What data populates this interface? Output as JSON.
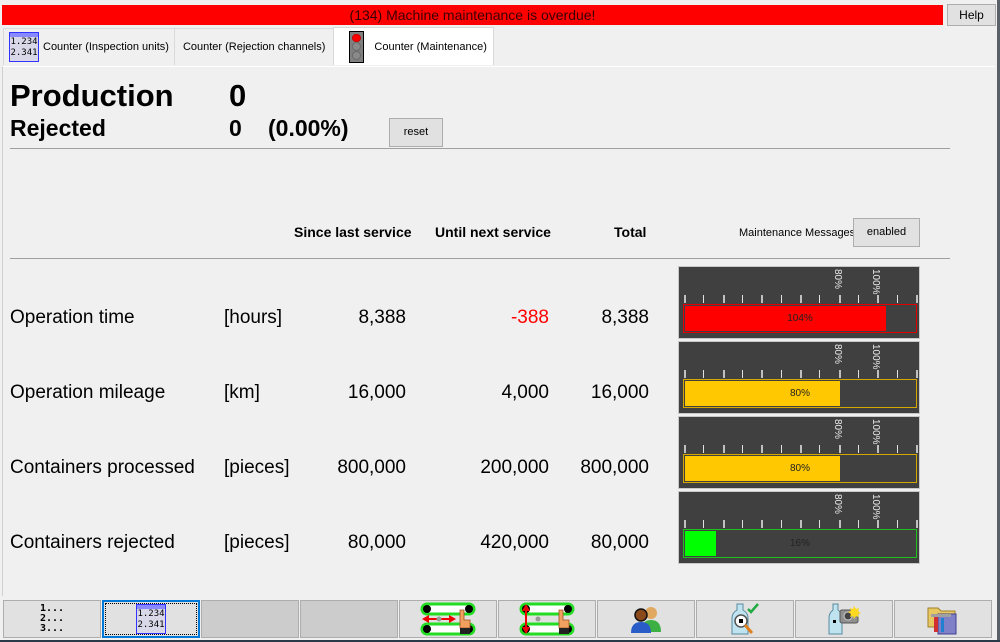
{
  "alarm": {
    "message": "(134) Machine maintenance is overdue!"
  },
  "help": {
    "label": "Help"
  },
  "tabs": [
    {
      "label": "Counter (Inspection units)",
      "icon": "counter-icon",
      "icon_text": [
        "1.234",
        "2.341"
      ]
    },
    {
      "label": "Counter (Rejection channels)"
    },
    {
      "label": "Counter (Maintenance)",
      "icon": "traffic-light-icon",
      "active": true
    }
  ],
  "summary": {
    "production_label": "Production",
    "production_value": "0",
    "rejected_label": "Rejected",
    "rejected_value": "0",
    "rejected_percent": "(0.00%)",
    "reset_label": "reset"
  },
  "table": {
    "headers": {
      "since_last_service": "Since last service",
      "until_next_service": "Until next service",
      "total": "Total"
    },
    "maintenance_messages_label": "Maintenance Messages",
    "maintenance_messages_button": "enabled",
    "rows": [
      {
        "label": "Operation time",
        "unit": "[hours]",
        "since": "8,388",
        "until": "-388",
        "until_negative": true,
        "total": "8,388",
        "gauge": {
          "percent": 104,
          "text": "104%",
          "color": "#ff0000",
          "border": "#e00000"
        }
      },
      {
        "label": "Operation mileage",
        "unit": "[km]",
        "since": "16,000",
        "until": "4,000",
        "total": "16,000",
        "gauge": {
          "percent": 80,
          "text": "80%",
          "color": "#ffc800",
          "border": "#d4a800"
        }
      },
      {
        "label": "Containers processed",
        "unit": "[pieces]",
        "since": "800,000",
        "until": "200,000",
        "total": "800,000",
        "gauge": {
          "percent": 80,
          "text": "80%",
          "color": "#ffc800",
          "border": "#d4a800"
        }
      },
      {
        "label": "Containers rejected",
        "unit": "[pieces]",
        "since": "80,000",
        "until": "420,000",
        "total": "80,000",
        "gauge": {
          "percent": 16,
          "text": "16%",
          "color": "#00ff00",
          "border": "#20c020"
        }
      }
    ],
    "gauge_marks": [
      "80%",
      "100%"
    ],
    "gauge_max_percent": 120
  },
  "toolbar": [
    {
      "name": "numbered-list-button",
      "icon": "numbered-list-icon",
      "icon_text": [
        "1...",
        "2...",
        "3..."
      ]
    },
    {
      "name": "counter-button",
      "icon": "counter-icon",
      "icon_text": [
        "1.234",
        "2.341"
      ],
      "selected": true
    },
    {
      "name": "empty-button-1",
      "disabled": true
    },
    {
      "name": "empty-button-2",
      "disabled": true
    },
    {
      "name": "horizontal-adjust-button",
      "icon": "horizontal-adjust-icon"
    },
    {
      "name": "vertical-adjust-button",
      "icon": "vertical-adjust-icon"
    },
    {
      "name": "users-button",
      "icon": "users-icon"
    },
    {
      "name": "bottle-inspect-button",
      "icon": "bottle-inspect-icon"
    },
    {
      "name": "bottle-camera-button",
      "icon": "bottle-camera-icon"
    },
    {
      "name": "tools-folder-button",
      "icon": "tools-folder-icon"
    }
  ]
}
